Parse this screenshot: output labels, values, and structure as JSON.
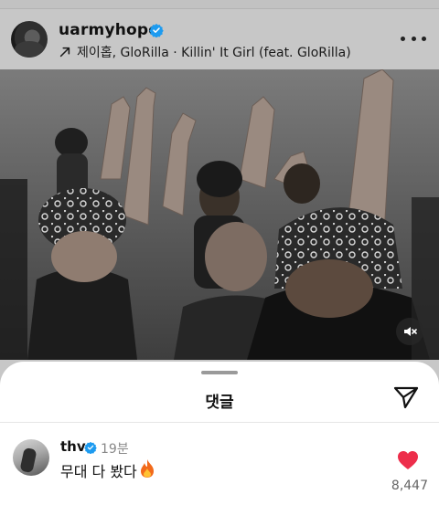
{
  "post": {
    "username": "uarmyhope",
    "audio": "제이홉, GloRilla · Killin' It Girl (feat. GloRilla)",
    "icons": {
      "avatar": "profile-avatar",
      "verified": "verified-badge-icon",
      "audio": "arrow-up-right-icon",
      "more": "more-horizontal-icon",
      "mute": "speaker-muted-icon"
    }
  },
  "comments_sheet": {
    "title": "댓글",
    "share_icon": "paper-plane-icon",
    "comments": [
      {
        "username": "thv",
        "time": "19분",
        "text": "무대 다 봤다",
        "emoji": "fire-icon",
        "likes": "8,447",
        "liked": true
      }
    ]
  },
  "colors": {
    "verified": "#1d9bf0",
    "like": "#ed2e4b",
    "dim_overlay": "#c7c7c7",
    "sheet": "#ffffff"
  }
}
